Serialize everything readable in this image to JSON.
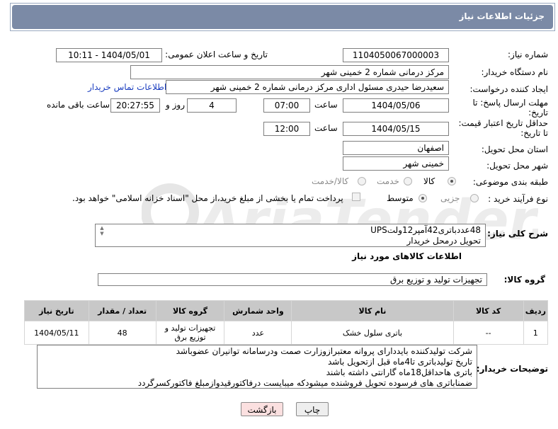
{
  "header": {
    "title": "جزئیات اطلاعات نیاز"
  },
  "fields": {
    "need_number_label": "شماره نیاز:",
    "need_number": "1104050067000003",
    "announce_label": "تاریخ و ساعت اعلان عمومی:",
    "announce_value": "1404/05/01 - 10:11",
    "buyer_org_label": "نام دستگاه خریدار:",
    "buyer_org": "مرکز درمانی شماره 2 خمینی شهر",
    "requester_label": "ایجاد کننده درخواست:",
    "requester": "سعیدرضا حیدری مسئول اداری مرکز درمانی شماره 2 خمینی شهر",
    "contact_link": "اطلاعات تماس خریدار",
    "deadline_label_1": "مهلت ارسال پاسخ: تا",
    "deadline_label_2": "تاریخ:",
    "deadline_date": "1404/05/06",
    "time_label": "ساعت",
    "deadline_time": "07:00",
    "days_value": "4",
    "days_label": "روز و",
    "remaining_time": "20:27:55",
    "remaining_label": "ساعت باقی مانده",
    "validity_label_1": "حداقل تاریخ اعتبار قیمت:",
    "validity_label_2": "تا تاریخ:",
    "validity_date": "1404/05/15",
    "validity_time": "12:00",
    "province_label": "استان محل تحویل:",
    "province": "اصفهان",
    "city_label": "شهر محل تحویل:",
    "city": "خمینی شهر",
    "category_label": "طبقه بندی موضوعی:",
    "category_options": [
      "کالا",
      "خدمت",
      "کالا/خدمت"
    ],
    "category_selected": "کالا",
    "process_label": "نوع فرآیند خرید :",
    "process_options": [
      "جزیی",
      "متوسط"
    ],
    "process_selected": "متوسط",
    "payment_note": "پرداخت تمام یا بخشی از مبلغ خرید،از محل \"اسناد خزانه اسلامی\" خواهد بود."
  },
  "description": {
    "label": "شرح کلی نیاز:",
    "line1": "48عددباتری42آمپر12ولتUPS",
    "line2": "تحویل درمحل خریدار"
  },
  "goods": {
    "section_title": "اطلاعات کالاهای مورد نیاز",
    "group_label": "گروه کالا:",
    "group_value": "تجهیزات تولید و توزیع برق",
    "columns": [
      "ردیف",
      "کد کالا",
      "نام کالا",
      "واحد شمارش",
      "گروه کالا",
      "تعداد / مقدار",
      "تاریخ نیاز"
    ],
    "rows": [
      {
        "row": "1",
        "code": "--",
        "name": "باتری سلول خشک",
        "unit": "عدد",
        "group": "تجهیزات تولید و توزیع برق",
        "qty": "48",
        "date": "1404/05/11"
      }
    ]
  },
  "buyer_notes": {
    "label": "توضیحات خریدار:",
    "lines": [
      "شرکت تولیدکننده بایددارای پروانه معتبرازوزارت صمت ودرسامانه توانیران عضوباشد",
      "تاریخ تولیدباتری تا4ماه قبل ازتحویل باشد",
      "باتری هاحداقل18ماه گارانتی داشته باشند",
      "ضمناباتری های فرسوده تحویل فروشنده میشودکه میبایست درفاکتورقیدوازمبلغ فاکتورکسرگردد"
    ]
  },
  "buttons": {
    "print": "چاپ",
    "back": "بازگشت"
  },
  "watermark": {
    "text": "AriaTender.neT"
  },
  "colors": {
    "titlebar": "#7b8aa6",
    "link": "#1a3dbf",
    "back_button": "#fbe0e0",
    "print_button": "#eeeeee"
  }
}
